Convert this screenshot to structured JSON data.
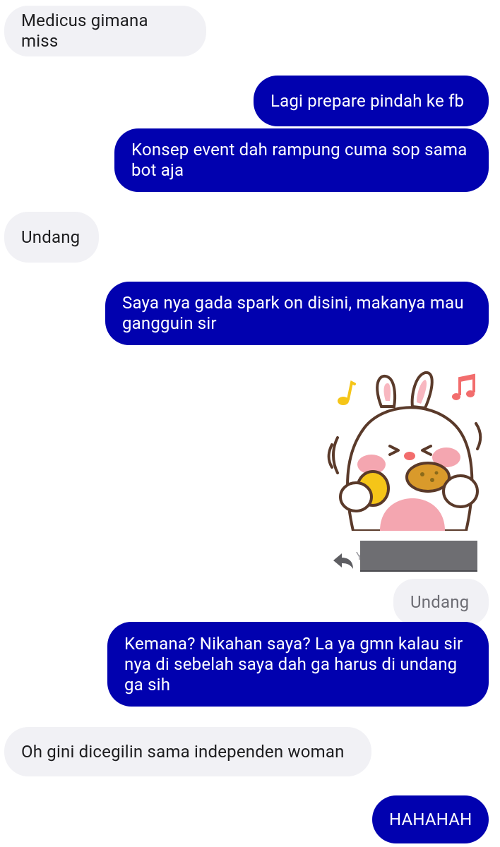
{
  "messages": [
    {
      "id": "m1",
      "direction": "incoming",
      "text": "Medicus gimana miss"
    },
    {
      "id": "m2",
      "direction": "outgoing",
      "text": "Lagi prepare pindah ke fb"
    },
    {
      "id": "m3",
      "direction": "outgoing",
      "text": "Konsep event dah rampung cuma sop sama\nbot aja"
    },
    {
      "id": "m4",
      "direction": "incoming",
      "text": "Undang"
    },
    {
      "id": "m5",
      "direction": "outgoing",
      "text": "Saya nya gada spark on disini, makanya mau\ngangguin sir"
    },
    {
      "id": "m6",
      "direction": "outgoing",
      "type": "sticker",
      "sticker": "bunny-eating-sticker"
    },
    {
      "id": "m7",
      "direction": "outgoing",
      "reply_to_letter": "Y",
      "quoted_text": "Undang"
    },
    {
      "id": "m8",
      "direction": "outgoing",
      "text": "Kemana? Nikahan saya? La ya gmn kalau sir\nnya di sebelah saya dah ga harus di undang\nga sih"
    },
    {
      "id": "m9",
      "direction": "incoming",
      "text": "Oh gini dicegilin sama independen woman"
    },
    {
      "id": "m10",
      "direction": "outgoing",
      "text": "HAHAHAH"
    }
  ],
  "colors": {
    "outgoing_bubble": "#0101af",
    "incoming_bubble": "#f1f1f5",
    "redaction": "#6e6e72"
  }
}
